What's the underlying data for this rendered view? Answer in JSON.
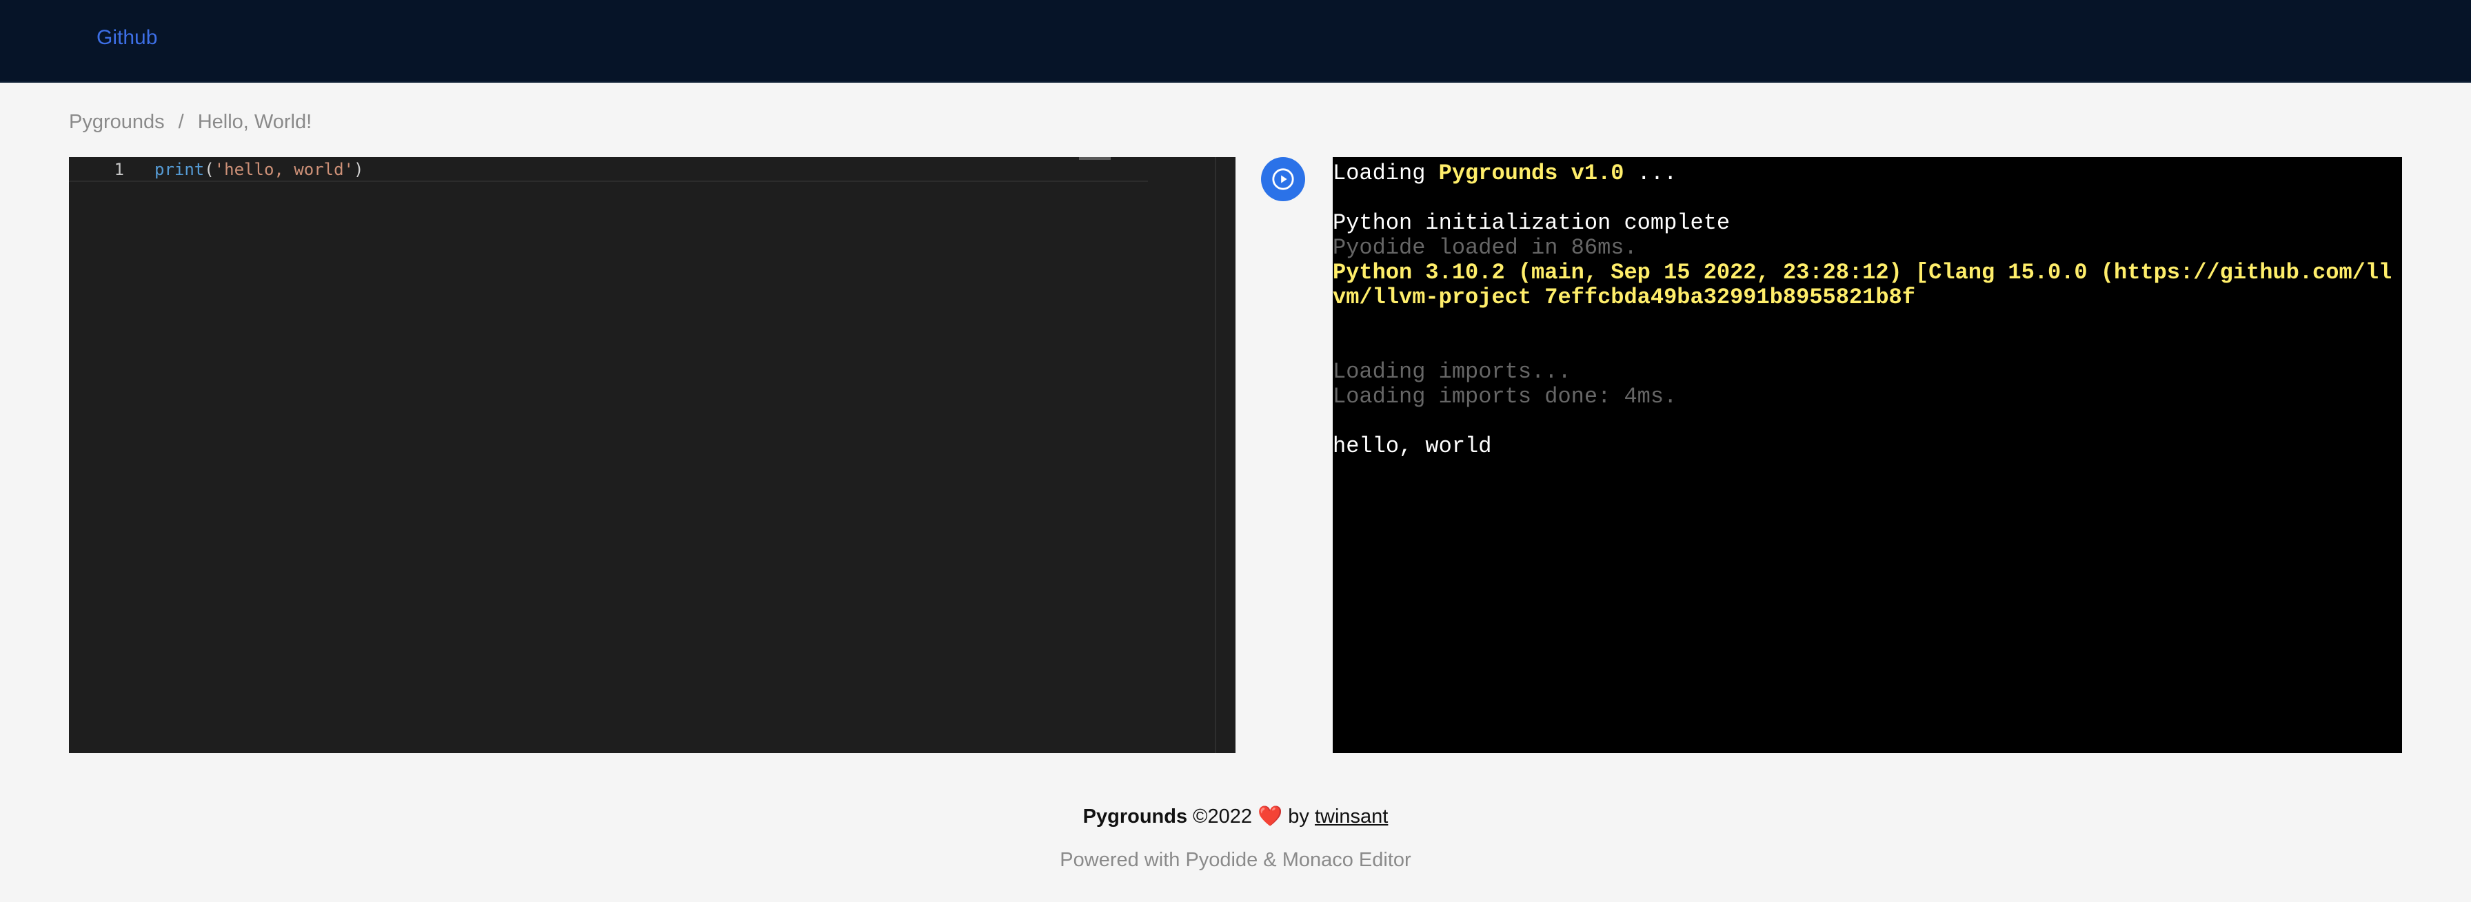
{
  "header": {
    "github_label": "Github"
  },
  "breadcrumb": {
    "root": "Pygrounds",
    "separator": "/",
    "current": "Hello, World!"
  },
  "editor": {
    "line_number": "1",
    "code": {
      "fn": "print",
      "open": "(",
      "string": "'hello, world'",
      "close": ")"
    }
  },
  "run_button": {
    "icon": "play-circle-icon"
  },
  "console": {
    "loading_prefix": "Loading ",
    "loading_name": "Pygrounds v1.0",
    "loading_suffix": " ...",
    "python_init": "Python initialization complete",
    "pyodide_loaded": "Pyodide loaded in 86ms.",
    "python_version": "Python 3.10.2 (main, Sep 15 2022, 23:28:12) [Clang 15.0.0 (https://github.com/llvm/llvm-project 7effcbda49ba32991b8955821b8f",
    "loading_imports": "Loading imports...",
    "imports_done": "Loading imports done: 4ms.",
    "output": "hello, world"
  },
  "footer": {
    "brand": "Pygrounds",
    "copyright": " ©2022 ",
    "heart": "❤️",
    "by": " by ",
    "author": "twinsant",
    "powered": "Powered with Pyodide & Monaco Editor"
  },
  "colors": {
    "header_bg": "#061428",
    "link_blue": "#3d6fe6",
    "run_button": "#2b72e8",
    "console_yellow": "#ffee6a"
  }
}
